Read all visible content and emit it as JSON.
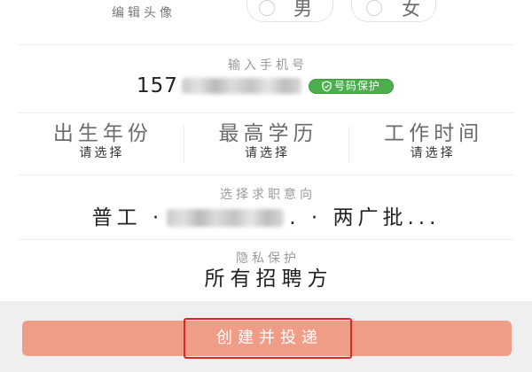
{
  "profile": {
    "avatar_label": "编辑头像",
    "gender_options": [
      {
        "label": "男"
      },
      {
        "label": "女"
      }
    ]
  },
  "phone": {
    "label": "输入手机号",
    "number_visible": "157",
    "protection_badge": "号码保护",
    "badge_icon": "shield-check-icon",
    "badge_color": "#4cae4c"
  },
  "selectors": [
    {
      "title": "出生年份",
      "value": "请选择"
    },
    {
      "title": "最高学历",
      "value": "请选择"
    },
    {
      "title": "工作时间",
      "value": "请选择"
    }
  ],
  "job_intent": {
    "label": "选择求职意向",
    "prefix": "普工 ·",
    "suffix": ". · 两广批..."
  },
  "privacy": {
    "label": "隐私保护",
    "value": "所有招聘方"
  },
  "submit": {
    "label": "创建并投递",
    "color": "#ef9d87"
  },
  "annotation": {
    "highlight_color": "#e3231d"
  }
}
